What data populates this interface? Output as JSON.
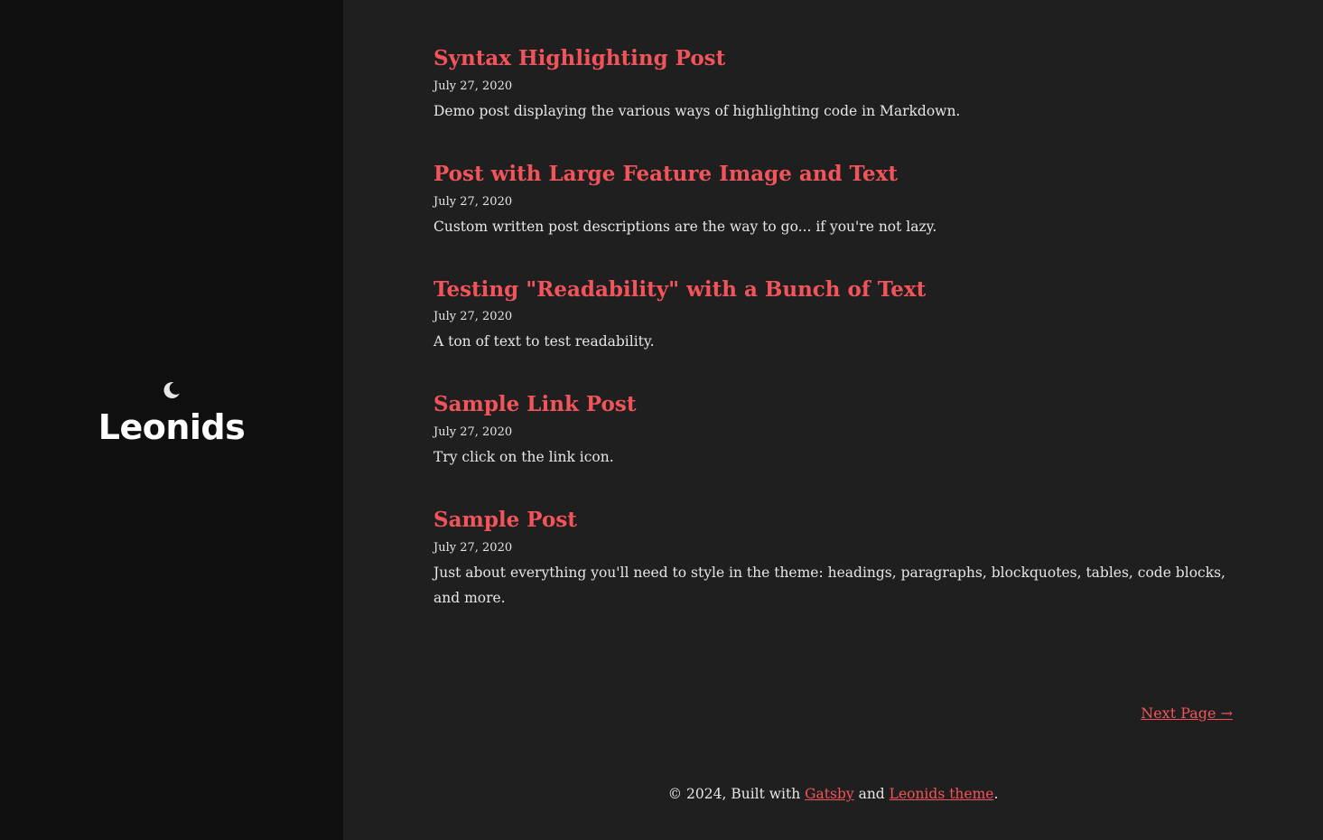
{
  "site": {
    "title": "Leonids",
    "toggle_icon": "moon-icon"
  },
  "colors": {
    "accent": "#f2545b",
    "sidebar_bg": "#0f0f0f",
    "main_bg": "#1f1f1f",
    "text": "#e6e6e6"
  },
  "posts": [
    {
      "title": "Syntax Highlighting Post",
      "date": "July 27, 2020",
      "description": "Demo post displaying the various ways of highlighting code in Markdown."
    },
    {
      "title": "Post with Large Feature Image and Text",
      "date": "July 27, 2020",
      "description": "Custom written post descriptions are the way to go... if you're not lazy."
    },
    {
      "title": "Testing \"Readability\" with a Bunch of Text",
      "date": "July 27, 2020",
      "description": "A ton of text to test readability."
    },
    {
      "title": "Sample Link Post",
      "date": "July 27, 2020",
      "description": "Try click on the link icon."
    },
    {
      "title": "Sample Post",
      "date": "July 27, 2020",
      "description": "Just about everything you'll need to style in the theme: headings, paragraphs, blockquotes, tables, code blocks, and more."
    }
  ],
  "pagination": {
    "next_label": "Next Page →"
  },
  "footer": {
    "prefix": "© 2024, Built with ",
    "gatsby_label": "Gatsby",
    "middle": " and ",
    "theme_label": "Leonids theme",
    "suffix": "."
  }
}
